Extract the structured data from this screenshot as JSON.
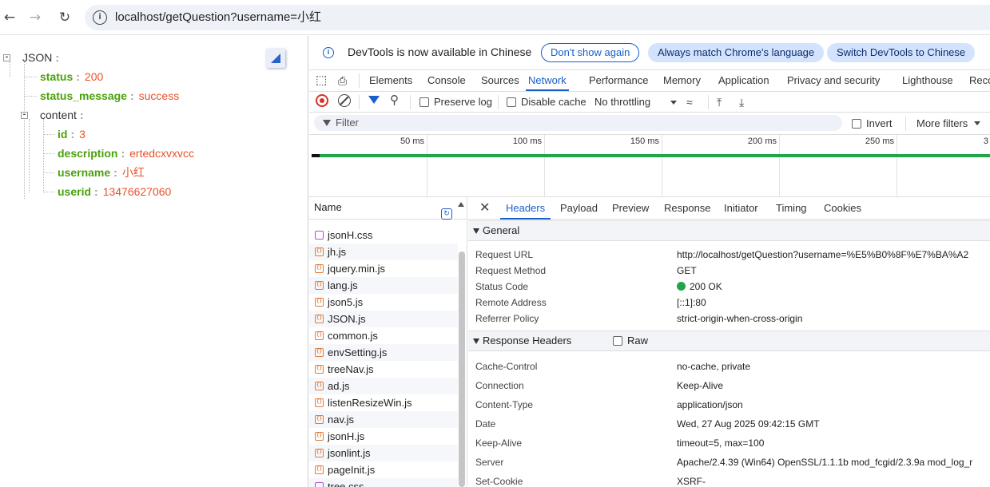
{
  "browser": {
    "url": "localhost/getQuestion?username=小红"
  },
  "json_view": {
    "root_key": "JSON",
    "rows": [
      {
        "key": "status",
        "value": "200"
      },
      {
        "key": "status_message",
        "value": "success"
      },
      {
        "key": "content",
        "value": ""
      },
      {
        "key": "id",
        "value": "3"
      },
      {
        "key": "description",
        "value": "ertedcxvxvcc"
      },
      {
        "key": "username",
        "value": "小红"
      },
      {
        "key": "userid",
        "value": "13476627060"
      }
    ]
  },
  "devtools": {
    "banner": {
      "text": "DevTools is now available in Chinese",
      "dont_show": "Don't show again",
      "match_lang": "Always match Chrome's language",
      "switch_lang": "Switch DevTools to Chinese"
    },
    "tabs": [
      "Elements",
      "Console",
      "Sources",
      "Network",
      "Performance",
      "Memory",
      "Application",
      "Privacy and security",
      "Lighthouse",
      "Reco"
    ],
    "active_tab": "Network",
    "toolbar": {
      "preserve_log": "Preserve log",
      "disable_cache": "Disable cache",
      "throttling": "No throttling"
    },
    "filter": {
      "placeholder": "Filter",
      "invert": "Invert",
      "more_filters": "More filters"
    },
    "timeline_ticks": [
      "50 ms",
      "100 ms",
      "150 ms",
      "200 ms",
      "250 ms",
      "3"
    ],
    "name_header": "Name",
    "files": [
      {
        "name": "jsonH.css",
        "type": "css"
      },
      {
        "name": "jh.js",
        "type": "js"
      },
      {
        "name": "jquery.min.js",
        "type": "js"
      },
      {
        "name": "lang.js",
        "type": "js"
      },
      {
        "name": "json5.js",
        "type": "js"
      },
      {
        "name": "JSON.js",
        "type": "js"
      },
      {
        "name": "common.js",
        "type": "js"
      },
      {
        "name": "envSetting.js",
        "type": "js"
      },
      {
        "name": "treeNav.js",
        "type": "js"
      },
      {
        "name": "ad.js",
        "type": "js"
      },
      {
        "name": "listenResizeWin.js",
        "type": "js"
      },
      {
        "name": "nav.js",
        "type": "js"
      },
      {
        "name": "jsonH.js",
        "type": "js"
      },
      {
        "name": "jsonlint.js",
        "type": "js"
      },
      {
        "name": "pageInit.js",
        "type": "js"
      },
      {
        "name": "tree.css",
        "type": "css"
      }
    ],
    "detail_tabs": [
      "Headers",
      "Payload",
      "Preview",
      "Response",
      "Initiator",
      "Timing",
      "Cookies"
    ],
    "active_detail_tab": "Headers",
    "general_title": "General",
    "general": [
      {
        "k": "Request URL",
        "v": "http://localhost/getQuestion?username=%E5%B0%8F%E7%BA%A2"
      },
      {
        "k": "Request Method",
        "v": "GET"
      },
      {
        "k": "Status Code",
        "v": "200 OK"
      },
      {
        "k": "Remote Address",
        "v": "[::1]:80"
      },
      {
        "k": "Referrer Policy",
        "v": "strict-origin-when-cross-origin"
      }
    ],
    "response_title": "Response Headers",
    "raw_label": "Raw",
    "response": [
      {
        "k": "Cache-Control",
        "v": "no-cache, private"
      },
      {
        "k": "Connection",
        "v": "Keep-Alive"
      },
      {
        "k": "Content-Type",
        "v": "application/json"
      },
      {
        "k": "Date",
        "v": "Wed, 27 Aug 2025 09:42:15 GMT"
      },
      {
        "k": "Keep-Alive",
        "v": "timeout=5, max=100"
      },
      {
        "k": "Server",
        "v": "Apache/2.4.39 (Win64) OpenSSL/1.1.1b mod_fcgid/2.3.9a mod_log_r"
      },
      {
        "k": "Set-Cookie",
        "v": "XSRF-"
      }
    ]
  }
}
